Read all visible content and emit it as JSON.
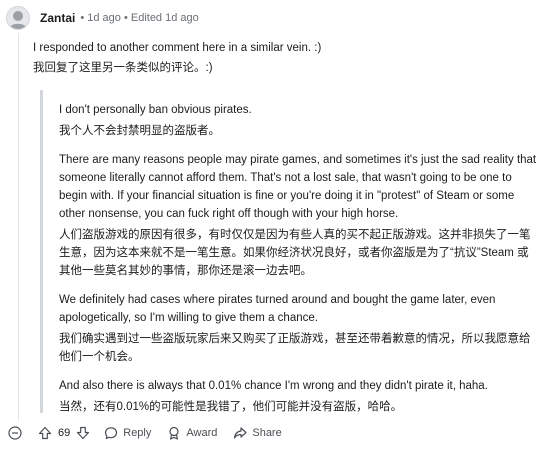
{
  "comment": {
    "author": "Zantai",
    "meta": "• 1d ago • Edited 1d ago",
    "body_en": "I responded to another comment here in a similar vein. :)",
    "body_cn": "我回复了这里另一条类似的评论。:)"
  },
  "quote": {
    "p1_en": "I don't personally ban obvious pirates.",
    "p1_cn": "我个人不会封禁明显的盗版者。",
    "p2_en": "There are many reasons people may pirate games, and sometimes it's just the sad reality that someone literally cannot afford them. That's not a lost sale, that wasn't going to be one to begin with. If your financial situation is fine or you're doing it in \"protest\" of Steam or some other nonsense, you can fuck right off though with your high horse.",
    "p2_cn": "人们盗版游戏的原因有很多，有时仅仅是因为有些人真的买不起正版游戏。这并非损失了一笔生意，因为这本来就不是一笔生意。如果你经济状况良好，或者你盗版是为了“抗议”Steam 或其他一些莫名其妙的事情，那你还是滚一边去吧。",
    "p3_en": "We definitely had cases where pirates turned around and bought the game later, even apologetically, so I'm willing to give them a chance.",
    "p3_cn": "我们确实遇到过一些盗版玩家后来又购买了正版游戏，甚至还带着歉意的情况，所以我愿意给他们一个机会。",
    "p4_en": "And also there is always that 0.01% chance I'm wrong and they didn't pirate it, haha.",
    "p4_cn": "当然，还有0.01%的可能性是我错了，他们可能并没有盗版，哈哈。"
  },
  "actions": {
    "vote_count": "69",
    "reply_label": "Reply",
    "award_label": "Award",
    "share_label": "Share"
  },
  "icons": [
    "collapse-icon",
    "upvote-icon",
    "downvote-icon",
    "reply-icon",
    "award-icon",
    "share-icon"
  ]
}
